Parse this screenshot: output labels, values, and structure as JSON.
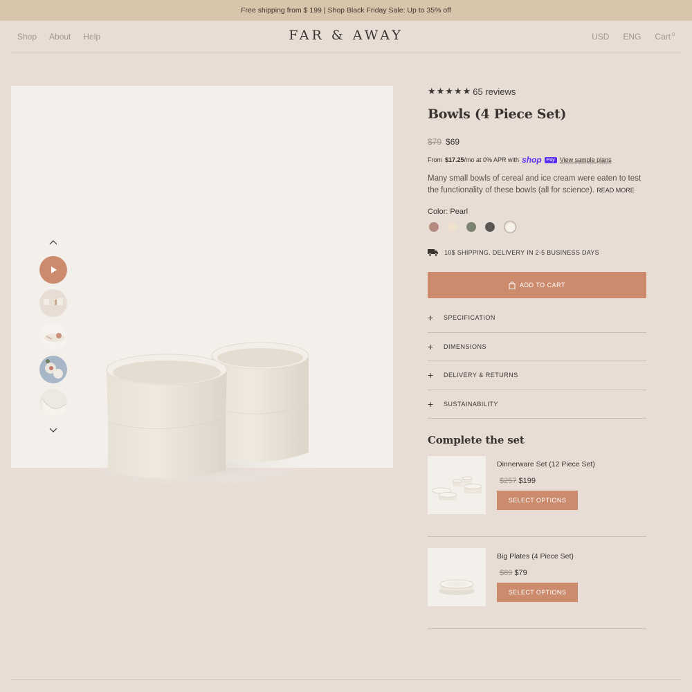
{
  "announcement": "Free shipping from $ 199 | Shop Black Friday Sale: Up to 35% off",
  "nav": {
    "left": [
      "Shop",
      "About",
      "Help"
    ],
    "logo": "FAR & AWAY",
    "currency": "USD",
    "language": "ENG",
    "cart_label": "Cart",
    "cart_count": "0"
  },
  "gallery": {
    "up_icon": "chevron-up-icon",
    "down_icon": "chevron-down-icon",
    "play_icon": "play-icon"
  },
  "product": {
    "rating_stars": 5,
    "reviews": "65 reviews",
    "title": "Bowls (4 Piece Set)",
    "old_price": "$79",
    "price": "$69",
    "installment_prefix": "From",
    "installment_amount": "$17.25",
    "installment_suffix": "/mo at 0% APR with",
    "shop_logo": "shop",
    "pay_badge": "Pay",
    "sample_link": "View sample plans",
    "description": "Many small bowls of cereal and ice cream were eaten to test the functionality of these bowls (all for science).",
    "read_more": "Read more",
    "color_label": "Color: Pearl",
    "swatches": [
      "#b58a80",
      "#f0e2cf",
      "#7b8470",
      "#5c5856",
      "#f6f2ea"
    ],
    "shipping": "10$ SHIPPING. DELIVERY IN 2-5 BUSINESS DAYS",
    "add_to_cart": "ADD TO CART"
  },
  "accordion": [
    "SPECIFICATION",
    "DIMENSIONS",
    "DELIVERY & RETURNS",
    "SUSTAINABILITY"
  ],
  "complete_set": {
    "title": "Complete the set",
    "items": [
      {
        "name": "Dinnerware Set (12 Piece Set)",
        "old_price": "$257",
        "price": "$199",
        "button": "SELECT OPTIONS"
      },
      {
        "name": "Big Plates (4 Piece Set)",
        "old_price": "$89",
        "price": "$79",
        "button": "SELECT OPTIONS"
      }
    ]
  },
  "colors": {
    "accent": "#cc8b6d",
    "background": "#e7ddd5",
    "announcement_bg": "#d8c6ac"
  }
}
